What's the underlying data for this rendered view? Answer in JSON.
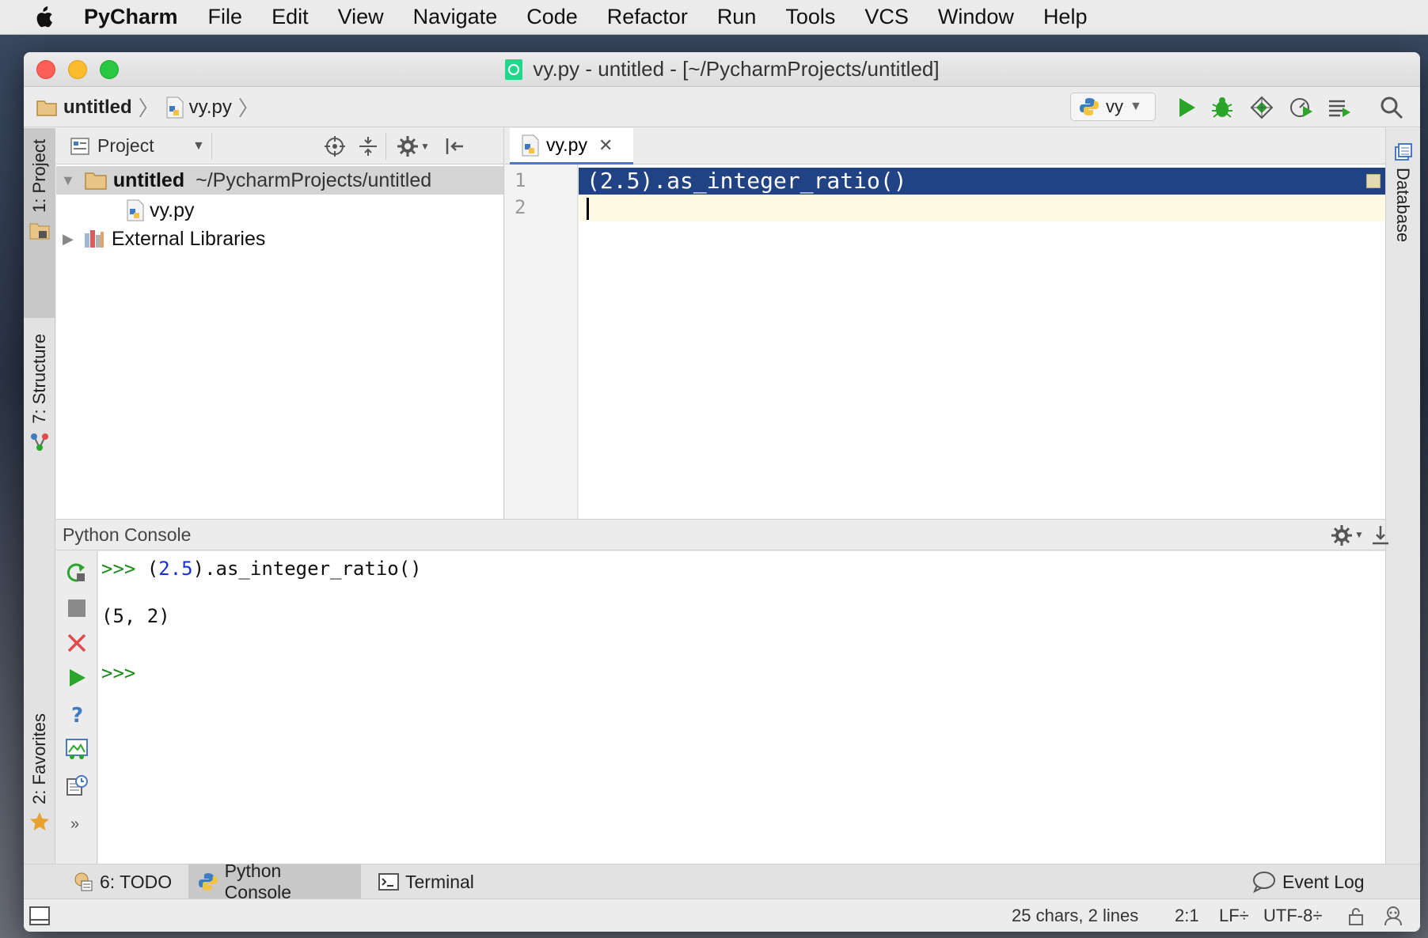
{
  "menubar": {
    "app_name": "PyCharm",
    "items": [
      "File",
      "Edit",
      "View",
      "Navigate",
      "Code",
      "Refactor",
      "Run",
      "Tools",
      "VCS",
      "Window",
      "Help"
    ]
  },
  "window": {
    "title": "vy.py - untitled - [~/PycharmProjects/untitled]"
  },
  "navbar": {
    "crumbs": [
      "untitled",
      "vy.py"
    ],
    "run_config": "vy"
  },
  "left_strip": {
    "project_tab": "1: Project",
    "structure_tab": "7: Structure",
    "favorites_tab": "2: Favorites"
  },
  "right_strip": {
    "database_tab": "Database"
  },
  "project_panel": {
    "header": "Project",
    "tree": [
      {
        "name": "untitled",
        "path": "~/PycharmProjects/untitled"
      },
      {
        "name": "vy.py"
      },
      {
        "name": "External Libraries"
      }
    ]
  },
  "editor": {
    "tab": "vy.py",
    "line_numbers": [
      "1",
      "2"
    ],
    "line1_code": "(2.5).as_integer_ratio()"
  },
  "console": {
    "title": "Python Console",
    "prompt": ">>>",
    "input_pre": " (",
    "input_num": "2.5",
    "input_post": ").as_integer_ratio()",
    "output": "(5, 2)"
  },
  "bottom_bar": {
    "todo": "6: TODO",
    "python_console": "Python Console",
    "terminal": "Terminal",
    "event_log": "Event Log"
  },
  "status_bar": {
    "chars": "25 chars, 2 lines",
    "position": "2:1",
    "line_sep": "LF÷",
    "encoding": "UTF-8÷"
  },
  "colors": {
    "selection": "#214283",
    "current_line": "#fffae3",
    "prompt": "#1a8a1a",
    "number": "#1530d6",
    "run_green": "#2aa52a"
  }
}
